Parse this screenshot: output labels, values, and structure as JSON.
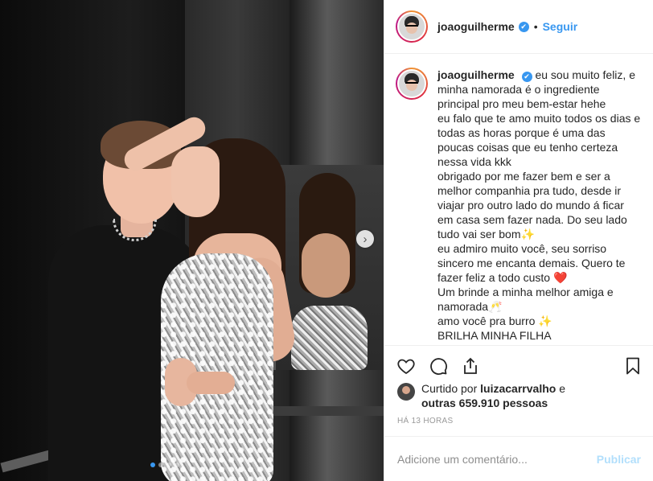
{
  "post": {
    "username": "joaoguilherme",
    "verified_mark": "✔",
    "separator": "•",
    "follow_label": "Seguir"
  },
  "caption": {
    "username": "joaoguilherme",
    "text": "eu sou muito feliz, e minha namorada é o ingrediente principal pro meu bem-estar hehe\neu falo que te amo muito todos os dias e todas as horas porque é uma das poucas coisas que eu tenho certeza nessa vida kkk\nobrigado por me fazer bem e ser a melhor companhia pra tudo, desde ir viajar pro outro lado do mundo á ficar em casa sem fazer nada. Do seu lado tudo vai ser bom✨\neu admiro muito você, seu sorriso sincero me encanta demais. Quero te fazer feliz a todo custo ❤️\nUm brinde a minha melhor amiga e namorada🥂\namo você pra burro ✨\nBRILHA MINHA FILHA"
  },
  "icons": {
    "like": "heart-icon",
    "comment": "comment-icon",
    "share": "share-icon",
    "save": "bookmark-icon",
    "next": "chevron-right-icon"
  },
  "likes": {
    "prefix": "Curtido por",
    "user": "luizacarrvalho",
    "conj": "e",
    "others": "outras 659.910 pessoas"
  },
  "timestamp": "HÁ 13 HORAS",
  "comment_box": {
    "placeholder": "Adicione um comentário...",
    "publish_label": "Publicar"
  },
  "carousel": {
    "current_index": 1,
    "total": 4
  },
  "colors": {
    "accent": "#3897f0",
    "publish_disabled": "#b2dffc",
    "muted": "#8e8e8e"
  }
}
